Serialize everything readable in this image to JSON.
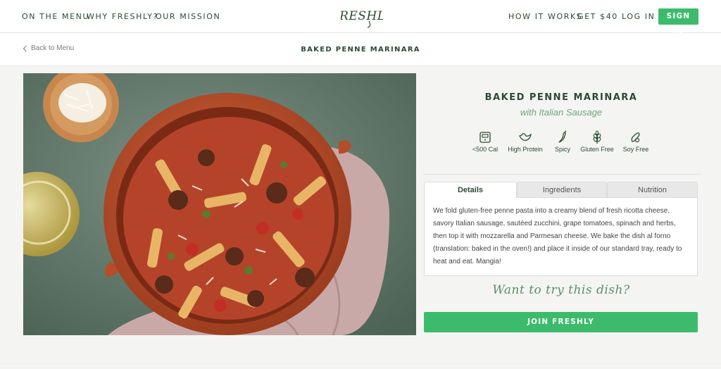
{
  "nav": {
    "left_links": [
      "ON THE MENU",
      "WHY FRESHLY?",
      "OUR MISSION"
    ],
    "logo_text": "FRESHLY",
    "right_links": [
      "HOW IT WORKS",
      "GET $40",
      "LOG IN"
    ],
    "signup_label": "SIGN UP"
  },
  "subheader": {
    "back_label": "Back to Menu",
    "title": "BAKED PENNE MARINARA"
  },
  "dish": {
    "title": "BAKED PENNE MARINARA",
    "subtitle": "with Italian Sausage",
    "badges": [
      {
        "icon": "scale-icon",
        "label": "<500 Cal"
      },
      {
        "icon": "muscle-icon",
        "label": "High Protein"
      },
      {
        "icon": "chili-pepper-icon",
        "label": "Spicy"
      },
      {
        "icon": "wheat-icon",
        "label": "Gluten Free"
      },
      {
        "icon": "soy-bean-icon",
        "label": "Soy Free"
      }
    ]
  },
  "tabs": {
    "items": [
      "Details",
      "Ingredients",
      "Nutrition"
    ],
    "active": "Details",
    "details_text": "We fold gluten-free penne pasta into a creamy blend of fresh ricotta cheese, savory Italian sausage, sautéed zucchini, grape tomatoes, spinach and herbs, then top it with mozzarella and Parmesan cheese. We bake the dish al forno (translation: baked in the oven!) and place it inside of our standard tray, ready to heat and eat. Mangia!"
  },
  "cta": {
    "prompt": "Want to try this dish?",
    "button_label": "JOIN FRESHLY"
  },
  "colors": {
    "brand_green": "#3dbb6c",
    "dark_green": "#2c4a33",
    "accent_green": "#6fa57a"
  }
}
